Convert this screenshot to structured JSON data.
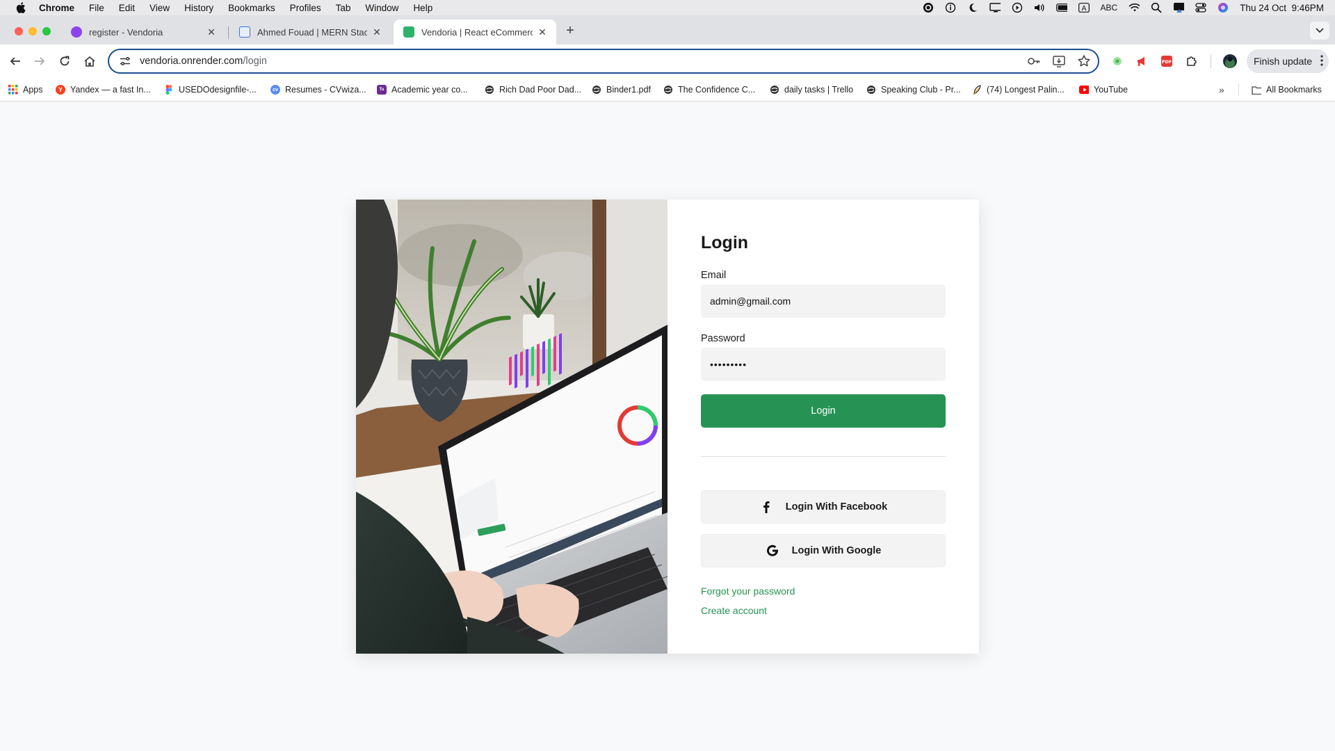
{
  "menubar": {
    "app_name": "Chrome",
    "items": [
      "File",
      "Edit",
      "View",
      "History",
      "Bookmarks",
      "Profiles",
      "Tab",
      "Window",
      "Help"
    ],
    "input_source": "ABC",
    "datetime": "Thu 24 Oct  9:46PM"
  },
  "tabs": [
    {
      "title": "register - Vendoria",
      "favicon_color": "#8e44ec"
    },
    {
      "title": "Ahmed Fouad | MERN Stack D",
      "favicon_color": "#3b6fd8"
    },
    {
      "title": "Vendoria | React eCommerce",
      "favicon_color": "#2fb36b"
    }
  ],
  "address_bar": {
    "host": "vendoria.onrender.com",
    "path": "/login"
  },
  "toolbar": {
    "finish_update": "Finish update"
  },
  "bookmarks": [
    {
      "label": "Apps",
      "icon": "apps-grid-icon"
    },
    {
      "label": "Yandex — a fast In...",
      "icon": "yandex-icon"
    },
    {
      "label": "USEDOdesignfile-...",
      "icon": "figma-icon"
    },
    {
      "label": "Resumes - CVwiza...",
      "icon": "cvwizard-icon"
    },
    {
      "label": "Academic year co...",
      "icon": "academic-icon"
    },
    {
      "label": "Rich Dad Poor Dad...",
      "icon": "globe-icon"
    },
    {
      "label": "Binder1.pdf",
      "icon": "globe-icon"
    },
    {
      "label": "The Confidence C...",
      "icon": "globe-icon"
    },
    {
      "label": "daily tasks | Trello",
      "icon": "globe-icon"
    },
    {
      "label": "Speaking Club - Pr...",
      "icon": "globe-icon"
    },
    {
      "label": "(74) Longest Palin...",
      "icon": "leaf-icon"
    },
    {
      "label": "YouTube",
      "icon": "youtube-icon"
    }
  ],
  "all_bookmarks": "All Bookmarks",
  "login": {
    "title": "Login",
    "email_label": "Email",
    "email_value": "admin@gmail.com",
    "password_label": "Password",
    "password_value": "•••••••••",
    "login_button": "Login",
    "facebook_button": "Login With Facebook",
    "google_button": "Login With Google",
    "forgot_link": "Forgot your password",
    "create_link": "Create account"
  },
  "colors": {
    "accent_green": "#269354",
    "address_focus": "#1a4d8f"
  }
}
